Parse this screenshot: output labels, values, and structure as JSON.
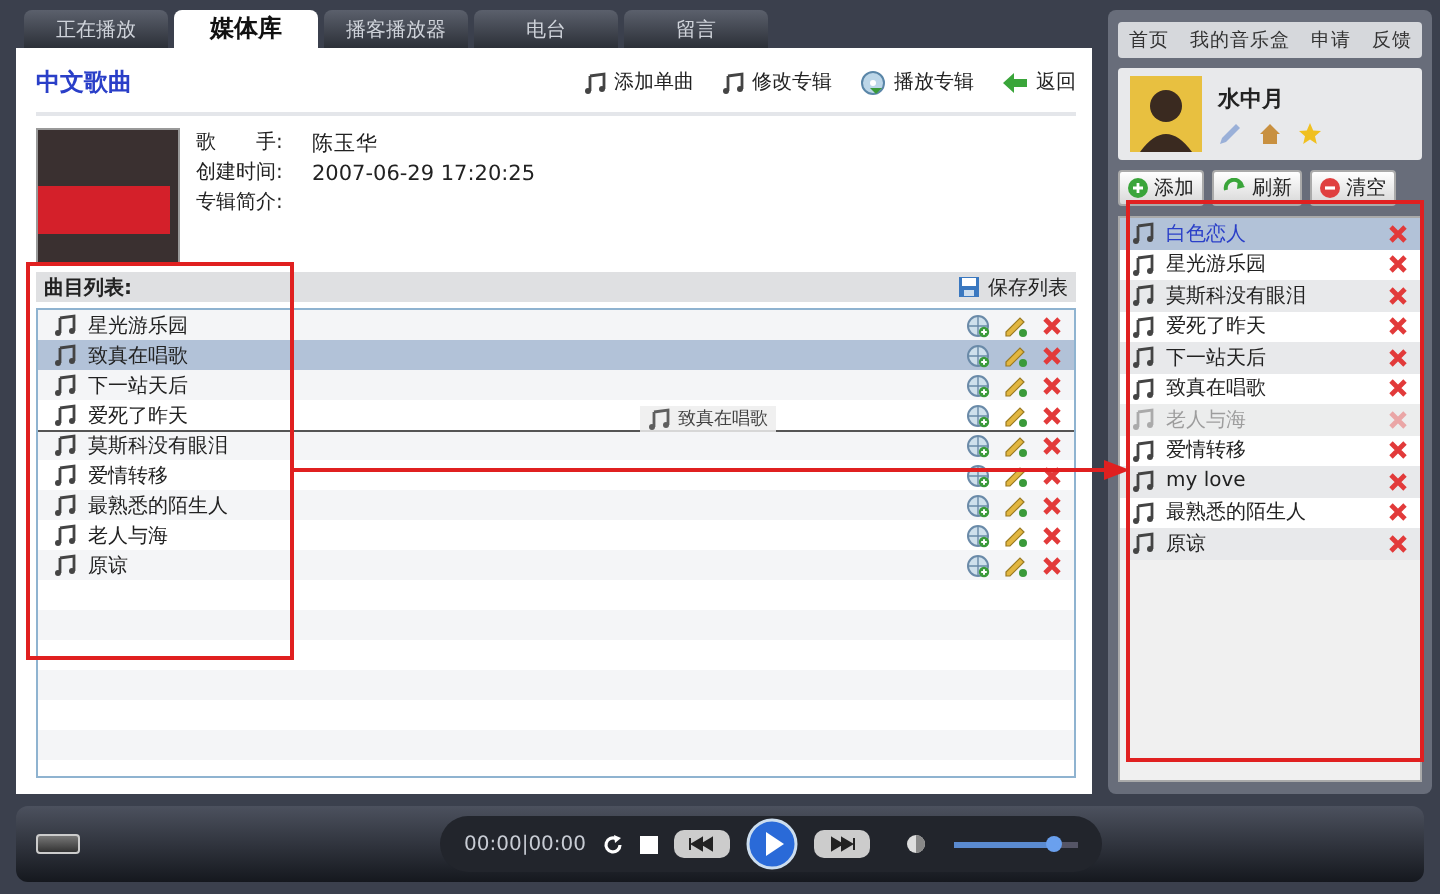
{
  "tabs": [
    {
      "label": "正在播放",
      "selected": false
    },
    {
      "label": "媒体库",
      "selected": true
    },
    {
      "label": "播客播放器",
      "selected": false
    },
    {
      "label": "电台",
      "selected": false
    },
    {
      "label": "留言",
      "selected": false
    }
  ],
  "album": {
    "title": "中文歌曲",
    "actions": [
      {
        "kind": "add",
        "label": "添加单曲"
      },
      {
        "kind": "edit",
        "label": "修改专辑"
      },
      {
        "kind": "play",
        "label": "播放专辑"
      },
      {
        "kind": "back",
        "label": "返回"
      }
    ],
    "fields": [
      {
        "label": "歌　　手:",
        "value": "陈玉华"
      },
      {
        "label": "创建时间:",
        "value": "2007-06-29 17:20:25"
      },
      {
        "label": "专辑简介:"
      }
    ]
  },
  "tracklist": {
    "label": "曲目列表:",
    "save": "保存列表",
    "rows": [
      {
        "title": "星光游乐园",
        "selected": false,
        "drop_above": false
      },
      {
        "title": "致真在唱歌",
        "selected": true,
        "drop_above": false
      },
      {
        "title": "下一站天后",
        "selected": false,
        "drop_above": false
      },
      {
        "title": "爱死了昨天",
        "selected": false,
        "drop_above": false
      },
      {
        "title": "莫斯科没有眼泪",
        "selected": false,
        "drop_above": true
      },
      {
        "title": "爱情转移",
        "selected": false,
        "drop_above": false
      },
      {
        "title": "最熟悉的陌生人",
        "selected": false,
        "drop_above": false
      },
      {
        "title": "老人与海",
        "selected": false,
        "drop_above": false
      },
      {
        "title": "原谅",
        "selected": false,
        "drop_above": false
      }
    ]
  },
  "drag_ghost": {
    "title": "致真在唱歌"
  },
  "sidebar": {
    "nav": [
      "首页",
      "我的音乐盒",
      "申请",
      "反馈"
    ],
    "user": {
      "name": "水中月"
    },
    "buttons": [
      {
        "kind": "add",
        "label": "添加"
      },
      {
        "kind": "refresh",
        "label": "刷新"
      },
      {
        "kind": "clear",
        "label": "清空"
      }
    ],
    "playlist": [
      {
        "title": "白色恋人",
        "selected": true,
        "dimmed": false
      },
      {
        "title": "星光游乐园",
        "selected": false,
        "dimmed": false
      },
      {
        "title": "莫斯科没有眼泪",
        "selected": false,
        "dimmed": false
      },
      {
        "title": "爱死了昨天",
        "selected": false,
        "dimmed": false
      },
      {
        "title": "下一站天后",
        "selected": false,
        "dimmed": false
      },
      {
        "title": "致真在唱歌",
        "selected": false,
        "dimmed": false
      },
      {
        "title": "老人与海",
        "selected": false,
        "dimmed": true
      },
      {
        "title": "爱情转移",
        "selected": false,
        "dimmed": false
      },
      {
        "title": "my love",
        "selected": false,
        "dimmed": false
      },
      {
        "title": "最熟悉的陌生人",
        "selected": false,
        "dimmed": false
      },
      {
        "title": "原谅",
        "selected": false,
        "dimmed": false
      }
    ]
  },
  "player": {
    "time": "00:00|00:00",
    "volume": {
      "level": 0.8
    }
  }
}
